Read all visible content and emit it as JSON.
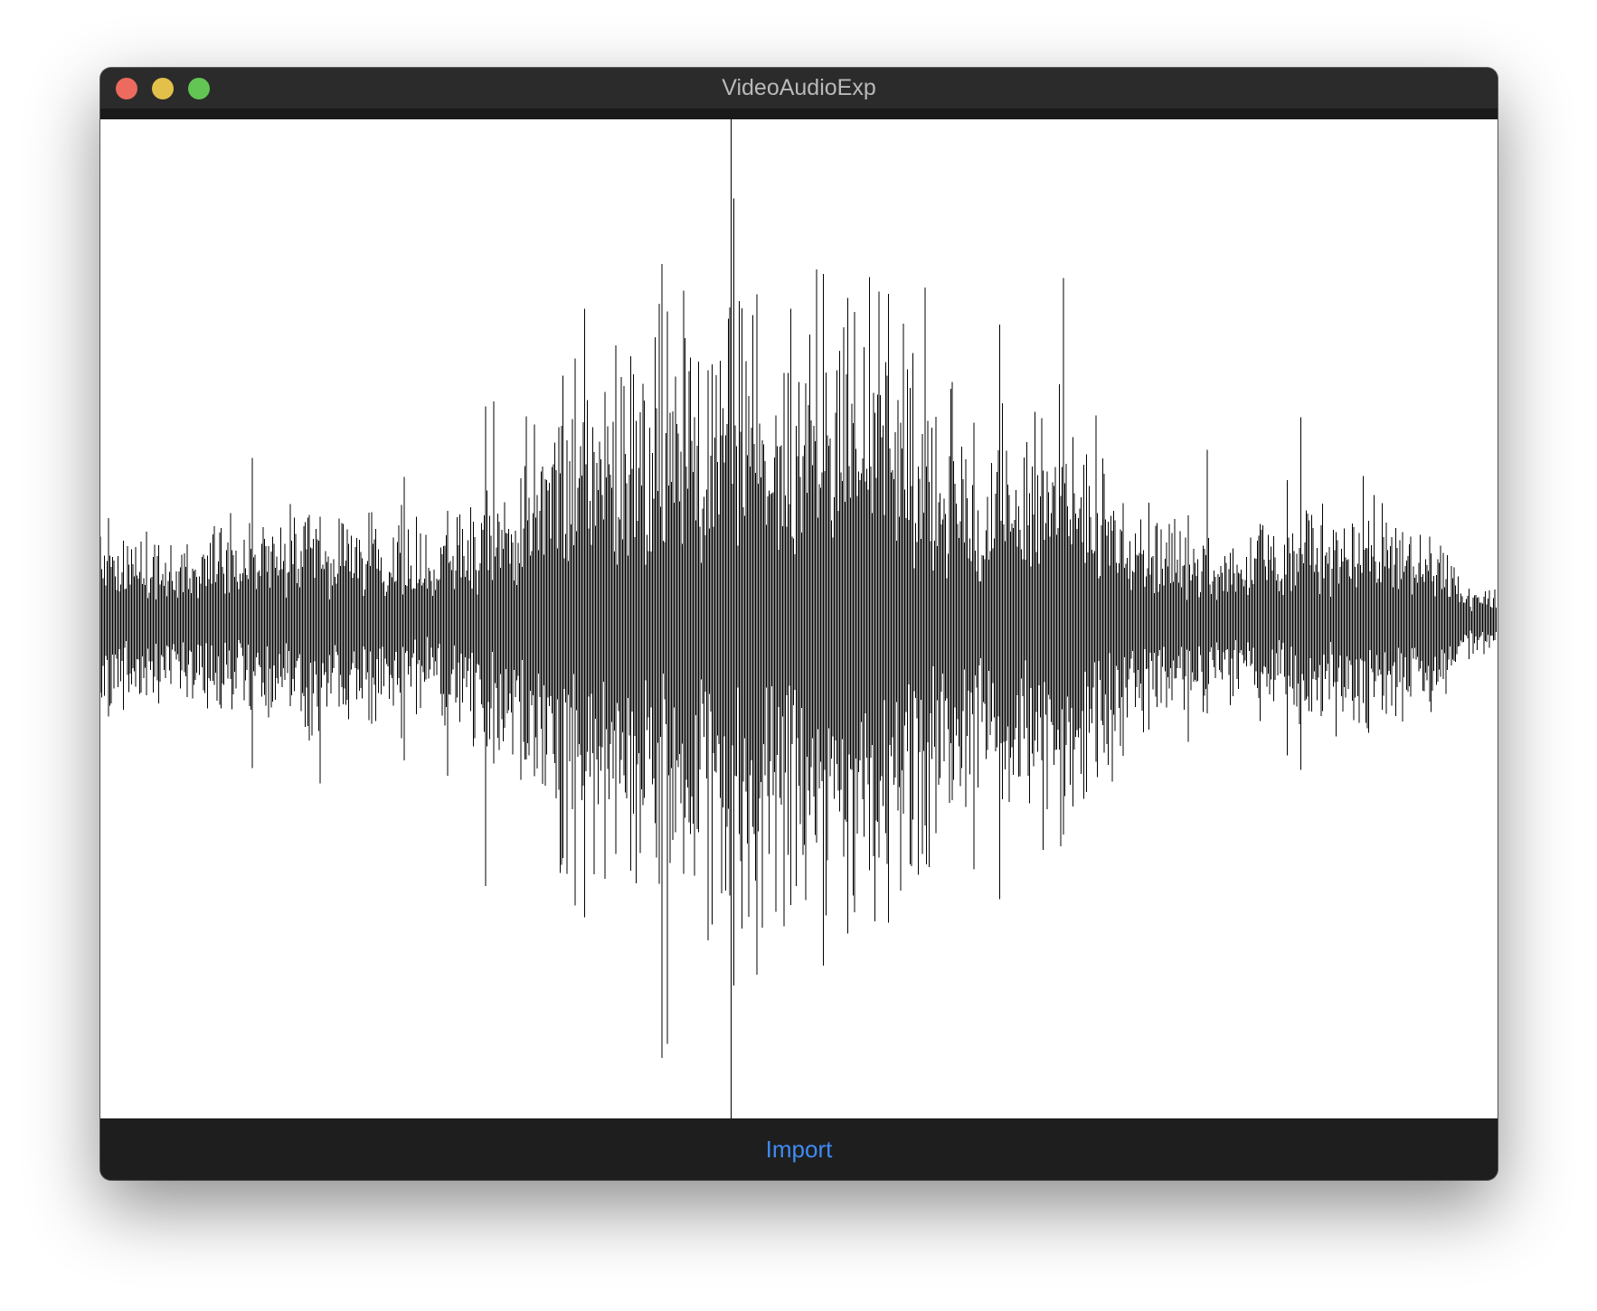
{
  "window": {
    "title": "VideoAudioExp",
    "controls": {
      "close_color": "#ed6a5e",
      "minimize_color": "#e2c04a",
      "zoom_color": "#62c554"
    }
  },
  "waveform": {
    "background": "#ffffff",
    "stroke_color": "#000000"
  },
  "bottom_bar": {
    "import_label": "Import",
    "import_color": "#3f8bf4"
  }
}
